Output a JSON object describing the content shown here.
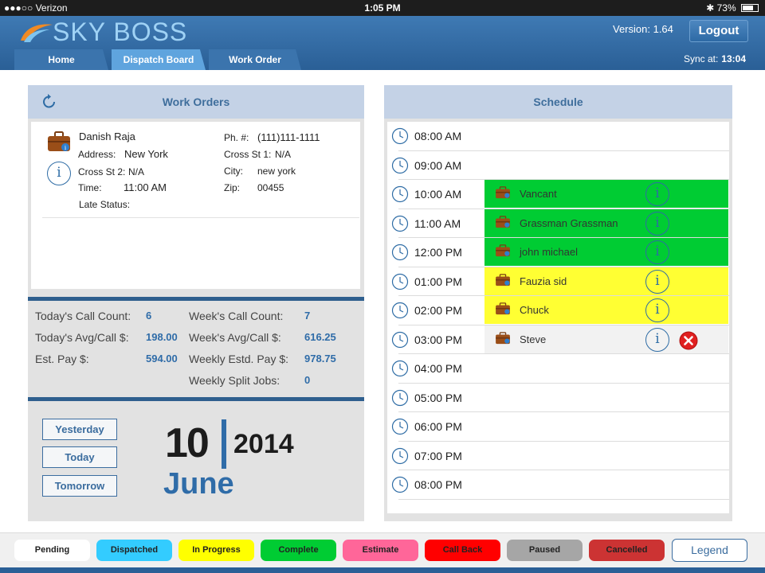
{
  "status_bar": {
    "carrier": "●●●○○ Verizon",
    "time": "1:05 PM",
    "battery": "73%"
  },
  "header": {
    "app_name": "SKY BOSS",
    "version": "Version: 1.64",
    "logout_label": "Logout",
    "sync_label": "Sync at:",
    "sync_time": "13:04",
    "tabs": [
      {
        "label": "Home",
        "active": false
      },
      {
        "label": "Dispatch Board",
        "active": true
      },
      {
        "label": "Work Order",
        "active": false
      }
    ]
  },
  "work_orders": {
    "title": "Work Orders",
    "card": {
      "name": "Danish Raja",
      "address_label": "Address:",
      "address": "New York",
      "cross2_label": "Cross St 2:",
      "cross2": "N/A",
      "time_label": "Time:",
      "time": "11:00 AM",
      "late_label": "Late Status:",
      "phone_label": "Ph. #:",
      "phone": "(111)111-1111",
      "cross1_label": "Cross St 1:",
      "cross1": "N/A",
      "city_label": "City:",
      "city": "new york",
      "zip_label": "Zip:",
      "zip": "00455"
    }
  },
  "stats": {
    "today_calls_label": "Today's Call Count:",
    "today_calls": "6",
    "today_avg_label": "Today's Avg/Call $:",
    "today_avg": "198.00",
    "est_pay_label": "Est. Pay $:",
    "est_pay": "594.00",
    "week_calls_label": "Week's Call Count:",
    "week_calls": "7",
    "week_avg_label": "Week's Avg/Call $:",
    "week_avg": "616.25",
    "weekly_pay_label": "Weekly Estd. Pay $:",
    "weekly_pay": "978.75",
    "weekly_split_label": "Weekly Split Jobs:",
    "weekly_split": "0"
  },
  "date_nav": {
    "yesterday": "Yesterday",
    "today": "Today",
    "tomorrow": "Tomorrow",
    "day": "10",
    "year": "2014",
    "month": "June"
  },
  "schedule": {
    "title": "Schedule",
    "slots": [
      {
        "time": "08:00 AM"
      },
      {
        "time": "09:00 AM"
      },
      {
        "time": "10:00 AM",
        "appt": {
          "name": "Vancant",
          "color": "#00cc33",
          "cancel": false
        }
      },
      {
        "time": "11:00 AM",
        "appt": {
          "name": "Grassman Grassman",
          "color": "#00cc33",
          "cancel": false
        }
      },
      {
        "time": "12:00 PM",
        "appt": {
          "name": "john michael",
          "color": "#00cc33",
          "cancel": false
        }
      },
      {
        "time": "01:00 PM",
        "appt": {
          "name": "Fauzia sid",
          "color": "#ffff33",
          "cancel": false
        }
      },
      {
        "time": "02:00 PM",
        "appt": {
          "name": "Chuck",
          "color": "#ffff33",
          "cancel": false
        }
      },
      {
        "time": "03:00 PM",
        "appt": {
          "name": "Steve",
          "color": "#f2f2f2",
          "cancel": true
        }
      },
      {
        "time": "04:00 PM"
      },
      {
        "time": "05:00 PM"
      },
      {
        "time": "06:00 PM"
      },
      {
        "time": "07:00 PM"
      },
      {
        "time": "08:00 PM"
      }
    ]
  },
  "legend": {
    "button_label": "Legend",
    "items": [
      {
        "label": "Pending",
        "color": "#ffffff"
      },
      {
        "label": "Dispatched",
        "color": "#33ccff"
      },
      {
        "label": "In Progress",
        "color": "#ffff00"
      },
      {
        "label": "Complete",
        "color": "#00cc33"
      },
      {
        "label": "Estimate",
        "color": "#ff6699"
      },
      {
        "label": "Call Back",
        "color": "#ff0000"
      },
      {
        "label": "Paused",
        "color": "#a6a6a6"
      },
      {
        "label": "Cancelled",
        "color": "#cc3333"
      }
    ]
  }
}
